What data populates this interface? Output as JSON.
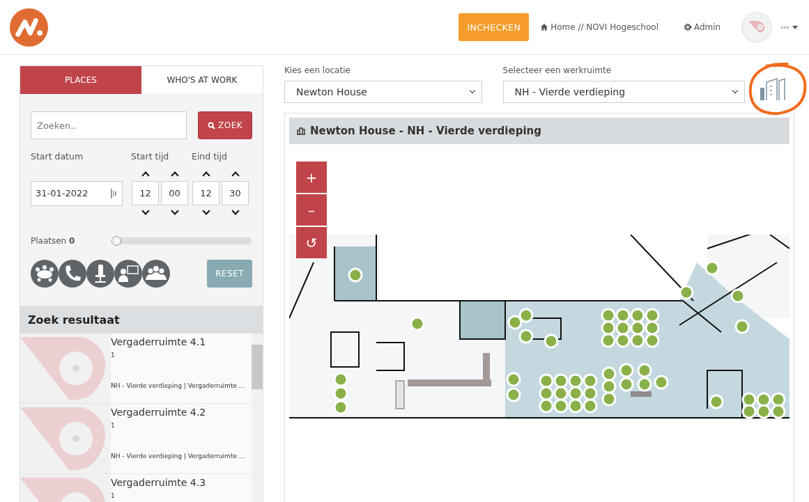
{
  "header": {
    "checkin_button": "INCHECKEN",
    "home_link": "Home // NOVI Hogeschool",
    "admin_link": "Admin",
    "user_menu": "◦◦◦"
  },
  "sidebar": {
    "tabs": [
      {
        "label": "PLACES",
        "selected": true
      },
      {
        "label": "WHO'S AT WORK",
        "selected": false
      }
    ],
    "search": {
      "placeholder": "Zoeken..",
      "button": "ZOEK"
    },
    "start_date": {
      "label": "Start datum",
      "value": "31-01-2022"
    },
    "start_time": {
      "label": "Start tijd",
      "hours": "12",
      "minutes": "00"
    },
    "end_time": {
      "label": "Eind tijd",
      "hours": "12",
      "minutes": "30"
    },
    "places": {
      "label": "Plaatsen",
      "value": "0",
      "level": 0
    },
    "filters": [
      {
        "kind": "meeting"
      },
      {
        "kind": "phone"
      },
      {
        "kind": "chair"
      },
      {
        "kind": "presentation"
      },
      {
        "kind": "group"
      }
    ],
    "reset_button": "RESET",
    "results": {
      "title": "Zoek resultaat",
      "items": [
        {
          "name": "Vergaderruimte 4.1",
          "capacity": "1",
          "location": "NH - Vierde verdieping | Vergaderruimte ..."
        },
        {
          "name": "Vergaderruimte 4.2",
          "capacity": "1",
          "location": "NH - Vierde verdieping | Vergaderruimte ..."
        },
        {
          "name": "Vergaderruimte 4.3",
          "capacity": "1"
        }
      ]
    }
  },
  "main": {
    "location": {
      "label": "Kies een locatie",
      "value": "Newton House"
    },
    "workspace": {
      "label": "Selecteer een werkruimte",
      "value": "NH - Vierde verdieping"
    },
    "map": {
      "title": "Newton House - NH - Vierde verdieping",
      "zoom_in": "+",
      "zoom_out": "–",
      "reset": "↺"
    }
  }
}
